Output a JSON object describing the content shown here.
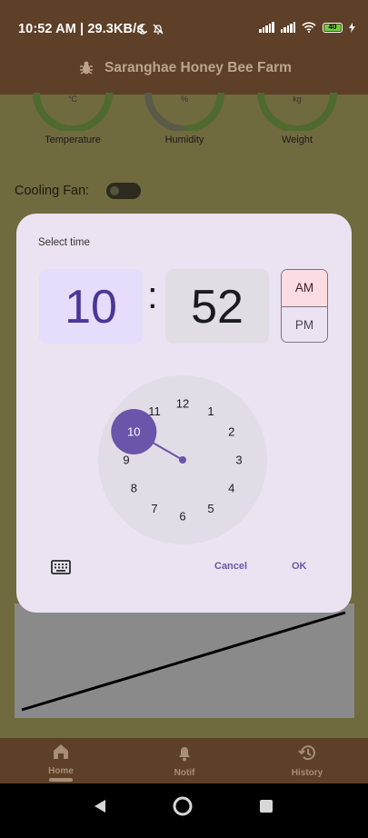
{
  "status_bar": {
    "time": "10:52 AM | 29.3KB/s",
    "battery": "40",
    "icons": [
      "moon-icon",
      "bell-off-icon",
      "signal-icon",
      "signal-icon",
      "wifi-icon",
      "battery-icon",
      "charging-icon"
    ]
  },
  "app_bar": {
    "title": "Saranghae Honey Bee Farm",
    "icon": "bug-icon"
  },
  "gauges": [
    {
      "label": "Temperature",
      "unit": "°C"
    },
    {
      "label": "Humidity",
      "unit": "%"
    },
    {
      "label": "Weight",
      "unit": "kg"
    }
  ],
  "cooling_fan": {
    "label": "Cooling Fan:",
    "on": false
  },
  "time_picker": {
    "title": "Select time",
    "hour": "10",
    "separator": ":",
    "minute": "52",
    "am_label": "AM",
    "pm_label": "PM",
    "selected_period": "AM",
    "selected_hour": 10,
    "dial_numbers": [
      "12",
      "1",
      "2",
      "3",
      "4",
      "5",
      "6",
      "7",
      "8",
      "9",
      "10",
      "11"
    ],
    "cancel_label": "Cancel",
    "ok_label": "OK"
  },
  "bottom_nav": [
    {
      "label": "Home",
      "icon": "home-icon",
      "active": true
    },
    {
      "label": "Notif",
      "icon": "bell-icon",
      "active": false
    },
    {
      "label": "History",
      "icon": "history-icon",
      "active": false
    }
  ],
  "colors": {
    "primary": "#6a55ab",
    "app_bar": "#5e3f27",
    "dialog_bg": "#ebe3f1",
    "am_selected": "#fbdce2"
  }
}
